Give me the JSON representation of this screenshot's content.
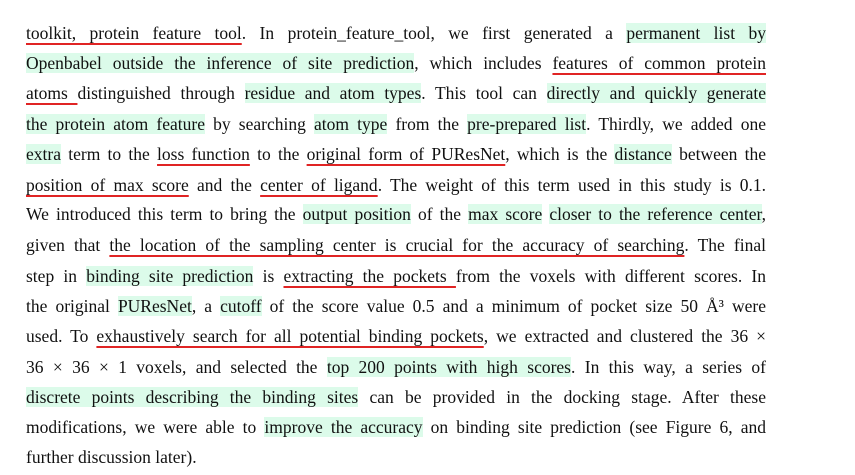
{
  "document": {
    "lines": [
      [
        {
          "t": "toolkit, protein feature tool",
          "s": "ul"
        },
        {
          "t": ". In protein_feature_tool, we first generated a ",
          "s": ""
        },
        {
          "t": "permanent list by",
          "s": "hl"
        }
      ],
      [
        {
          "t": "Openbabel outside the inference of site prediction",
          "s": "hl"
        },
        {
          "t": ", which includes ",
          "s": ""
        },
        {
          "t": "features of common protein",
          "s": "ul"
        }
      ],
      [
        {
          "t": "atoms ",
          "s": "ul"
        },
        {
          "t": "distinguished through ",
          "s": ""
        },
        {
          "t": "residue and atom types",
          "s": "hl"
        },
        {
          "t": ". This tool can ",
          "s": ""
        },
        {
          "t": "directly and quickly generate",
          "s": "hl"
        }
      ],
      [
        {
          "t": "the protein atom feature",
          "s": "hl"
        },
        {
          "t": " by searching ",
          "s": ""
        },
        {
          "t": "atom type",
          "s": "hl"
        },
        {
          "t": " from the ",
          "s": ""
        },
        {
          "t": "pre-prepared list",
          "s": "hl"
        },
        {
          "t": ". Thirdly, we added one",
          "s": ""
        }
      ],
      [
        {
          "t": "extra",
          "s": "hl"
        },
        {
          "t": " term to the ",
          "s": ""
        },
        {
          "t": "loss function",
          "s": "ul"
        },
        {
          "t": " to the ",
          "s": ""
        },
        {
          "t": "original form of PUResNet",
          "s": "ul"
        },
        {
          "t": ", which is the ",
          "s": ""
        },
        {
          "t": "distance",
          "s": "hl"
        },
        {
          "t": " between the",
          "s": ""
        }
      ],
      [
        {
          "t": "position of max score",
          "s": "ul"
        },
        {
          "t": " and the ",
          "s": ""
        },
        {
          "t": "center of ligand",
          "s": "ul"
        },
        {
          "t": ". The weight of this term used in this study is 0.1.",
          "s": ""
        }
      ],
      [
        {
          "t": "We introduced this term to bring the ",
          "s": ""
        },
        {
          "t": "output position",
          "s": "hl"
        },
        {
          "t": " of the ",
          "s": ""
        },
        {
          "t": "max score",
          "s": "hl"
        },
        {
          "t": " ",
          "s": ""
        },
        {
          "t": "closer to the reference center",
          "s": "hl"
        },
        {
          "t": ",",
          "s": ""
        }
      ],
      [
        {
          "t": "given that ",
          "s": ""
        },
        {
          "t": "the location of the sampling center is crucial for the accuracy of searching",
          "s": "ul"
        },
        {
          "t": ". The final",
          "s": ""
        }
      ],
      [
        {
          "t": "step in ",
          "s": ""
        },
        {
          "t": "binding site prediction",
          "s": "hl"
        },
        {
          "t": " is ",
          "s": ""
        },
        {
          "t": "extracting the pockets ",
          "s": "ul"
        },
        {
          "t": "from the voxels with different scores. In",
          "s": ""
        }
      ],
      [
        {
          "t": "the original ",
          "s": ""
        },
        {
          "t": "PUResNet",
          "s": "hl"
        },
        {
          "t": ", a ",
          "s": ""
        },
        {
          "t": "cutoff",
          "s": "hl"
        },
        {
          "t": " of the score value 0.5 and a minimum of pocket size 50 Å³ were",
          "s": ""
        }
      ],
      [
        {
          "t": "used. To ",
          "s": ""
        },
        {
          "t": "exhaustively search for all potential binding pockets",
          "s": "ul"
        },
        {
          "t": ", we extracted and clustered the 36 ×",
          "s": ""
        }
      ],
      [
        {
          "t": "36 × 36 × 1 voxels, and selected the ",
          "s": ""
        },
        {
          "t": "top 200 points with high scores",
          "s": "hl"
        },
        {
          "t": ". In this way, a series of",
          "s": ""
        }
      ],
      [
        {
          "t": "discrete points describing the binding sites",
          "s": "hl"
        },
        {
          "t": " can be provided in the docking stage. After these",
          "s": ""
        }
      ],
      [
        {
          "t": "modifications, we were able to ",
          "s": ""
        },
        {
          "t": "improve the accuracy",
          "s": "hl"
        },
        {
          "t": " on binding site prediction (see Figure 6, and",
          "s": ""
        }
      ],
      [
        {
          "t": "further discussion later).",
          "s": ""
        }
      ]
    ]
  }
}
